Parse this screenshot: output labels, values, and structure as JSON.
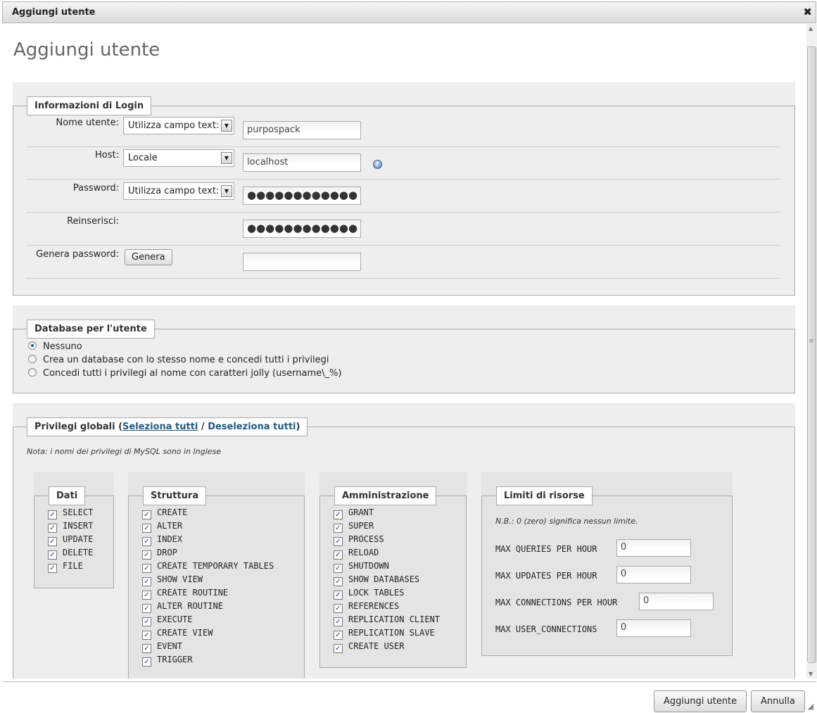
{
  "dialog": {
    "title": "Aggiungi utente",
    "close_symbol": "✖"
  },
  "page_title": "Aggiungi utente",
  "login": {
    "legend": "Informazioni di Login",
    "username": {
      "label": "Nome utente:",
      "select": "Utilizza campo text:",
      "value": "purpospack"
    },
    "host": {
      "label": "Host:",
      "select": "Locale",
      "value": "localhost",
      "help_symbol": "?"
    },
    "password": {
      "label": "Password:",
      "select": "Utilizza campo text:",
      "value": "●●●●●●●●●●●●"
    },
    "retype": {
      "label": "Reinserisci:",
      "value": "●●●●●●●●●●●●"
    },
    "generate": {
      "label": "Genera password:",
      "button": "Genera",
      "value": ""
    }
  },
  "database": {
    "legend": "Database per l'utente",
    "options": [
      {
        "label": "Nessuno",
        "selected": true
      },
      {
        "label": "Crea un database con lo stesso nome e concedi tutti i privilegi",
        "selected": false
      },
      {
        "label": "Concedi tutti i privilegi al nome con caratteri jolly (username\\_%)",
        "selected": false
      }
    ]
  },
  "privileges": {
    "legend_prefix": "Privilegi globali (",
    "select_all": "Seleziona tutti",
    "slash": " / ",
    "deselect_all": "Deseleziona tutti",
    "legend_suffix": ")",
    "note": "Nota: i nomi dei privilegi di MySQL sono in Inglese",
    "check_symbol": "✓",
    "dati": {
      "legend": "Dati",
      "items": [
        "SELECT",
        "INSERT",
        "UPDATE",
        "DELETE",
        "FILE"
      ]
    },
    "struttura": {
      "legend": "Struttura",
      "items": [
        "CREATE",
        "ALTER",
        "INDEX",
        "DROP",
        "CREATE TEMPORARY TABLES",
        "SHOW VIEW",
        "CREATE ROUTINE",
        "ALTER ROUTINE",
        "EXECUTE",
        "CREATE VIEW",
        "EVENT",
        "TRIGGER"
      ]
    },
    "amministrazione": {
      "legend": "Amministrazione",
      "items": [
        "GRANT",
        "SUPER",
        "PROCESS",
        "RELOAD",
        "SHUTDOWN",
        "SHOW DATABASES",
        "LOCK TABLES",
        "REFERENCES",
        "REPLICATION CLIENT",
        "REPLICATION SLAVE",
        "CREATE USER"
      ]
    },
    "limiti": {
      "legend": "Limiti di risorse",
      "note": "N.B.: 0 (zero) significa nessun limite.",
      "max_queries": {
        "label": "MAX QUERIES PER HOUR",
        "value": "0"
      },
      "max_updates": {
        "label": "MAX UPDATES PER HOUR",
        "value": "0"
      },
      "max_connections": {
        "label": "MAX CONNECTIONS PER HOUR",
        "value": "0"
      },
      "max_user_connections": {
        "label": "MAX USER_CONNECTIONS",
        "value": "0"
      }
    }
  },
  "footer": {
    "add_button": "Aggiungi utente",
    "cancel_button": "Annulla",
    "grip_symbol": "◢"
  },
  "scrollbar": {
    "up": "▲",
    "down": "▼",
    "grip": "≡"
  }
}
